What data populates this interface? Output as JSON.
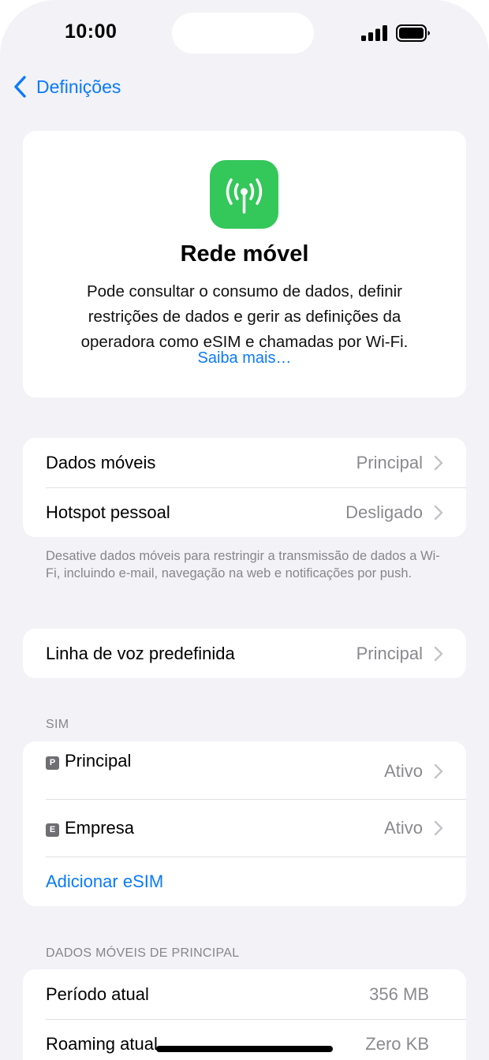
{
  "status": {
    "time": "10:00"
  },
  "nav": {
    "back_label": "Definições"
  },
  "hero": {
    "icon": "antenna-radiowaves-icon",
    "title": "Rede móvel",
    "description": "Pode consultar o consumo de dados, definir restrições de dados e gerir as definições da operadora como eSIM e chamadas por Wi-Fi.",
    "link": "Saiba mais…",
    "icon_color": "#34c759"
  },
  "data_group": {
    "rows": [
      {
        "label": "Dados móveis",
        "value": "Principal"
      },
      {
        "label": "Hotspot pessoal",
        "value": "Desligado"
      }
    ],
    "footer": "Desative dados móveis para restringir a transmissão de dados a Wi-Fi, incluindo e-mail, navegação na web e notificações por push."
  },
  "voice_group": {
    "rows": [
      {
        "label": "Linha de voz predefinida",
        "value": "Principal"
      }
    ]
  },
  "sim_section": {
    "header": "SIM",
    "lines": [
      {
        "badge": "P",
        "name": "Principal",
        "status": "Ativo"
      },
      {
        "badge": "E",
        "name": "Empresa",
        "status": "Ativo"
      }
    ],
    "add_label": "Adicionar eSIM"
  },
  "usage_section": {
    "header": "DADOS MÓVEIS DE PRINCIPAL",
    "rows": [
      {
        "label": "Período atual",
        "value": "356 MB"
      },
      {
        "label": "Roaming atual",
        "value": "Zero KB"
      }
    ]
  },
  "colors": {
    "accent": "#0a7aff",
    "background": "#f2f2f7",
    "secondary_text": "#8a8a8e"
  }
}
